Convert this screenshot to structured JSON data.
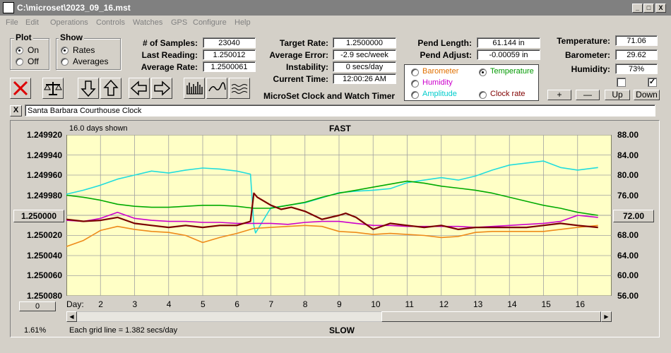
{
  "window": {
    "title": "C:\\microset\\2023_09_16.mst",
    "minimize": "_",
    "maximize": "□",
    "close": "X"
  },
  "menu": [
    "File",
    "Edit",
    "Operations",
    "Controls",
    "Watches",
    "GPS",
    "Configure",
    "Help"
  ],
  "plot_group": {
    "title": "Plot",
    "options": [
      "On",
      "Off"
    ],
    "selected": "On"
  },
  "show_group": {
    "title": "Show",
    "options": [
      "Rates",
      "Averages"
    ],
    "selected": "Rates"
  },
  "stats": {
    "samples_label": "# of Samples:",
    "samples": "23040",
    "last_label": "Last Reading:",
    "last": "1.250012",
    "avg_label": "Average Rate:",
    "avg": "1.2500061",
    "target_label": "Target Rate:",
    "target": "1.2500000",
    "err_label": "Average Error:",
    "err": "-2.9 sec/week",
    "inst_label": "Instability:",
    "inst": "0 secs/day",
    "time_label": "Current Time:",
    "time": "12:00:26 AM",
    "pend_label": "Pend Length:",
    "pend": "61.144 in",
    "adjust_label": "Pend Adjust:",
    "adjust": "-0.00059 in",
    "temp_label": "Temperature:",
    "temp": "71.06",
    "baro_label": "Barometer:",
    "baro": "29.62",
    "hum_label": "Humidity:",
    "hum": "73%"
  },
  "app_title": "MicroSet Clock and Watch Timer",
  "series_select": {
    "options": [
      {
        "label": "Barometer",
        "color": "#e07000",
        "selected": false
      },
      {
        "label": "Temperature",
        "color": "#009900",
        "selected": true
      },
      {
        "label": "Humidity",
        "color": "#cc00cc",
        "selected": false
      },
      {
        "label": "Clock rate",
        "color": "#800000",
        "selected": false
      },
      {
        "label": "Amplitude",
        "color": "#00cccc",
        "selected": false
      }
    ]
  },
  "scale_buttons": [
    "+",
    "—",
    "Up",
    "Down"
  ],
  "checkboxes": [
    false,
    true
  ],
  "clock_name": "Santa Barbara Courthouse Clock",
  "clock_close": "X",
  "chart": {
    "days_shown": "16.0 days shown",
    "top_label": "FAST",
    "bottom_label": "SLOW",
    "y_left_ticks": [
      "1.249920",
      "1.249940",
      "1.249960",
      "1.249980",
      "1.250000",
      "1.250020",
      "1.250040",
      "1.250060",
      "1.250080"
    ],
    "y_right_ticks": [
      "88.00",
      "84.00",
      "80.00",
      "76.00",
      "72.00",
      "68.00",
      "64.00",
      "60.00",
      "56.00"
    ],
    "x_ticks": [
      "Day:",
      "2",
      "3",
      "4",
      "5",
      "6",
      "7",
      "8",
      "9",
      "10",
      "11",
      "12",
      "13",
      "14",
      "15",
      "16"
    ],
    "left_center_button": "1.250000",
    "right_center_button": "72.00",
    "zero_button": "0",
    "percent": "1.61%",
    "grid_note": "Each grid line = 1.382 secs/day"
  },
  "chart_data": {
    "type": "line",
    "x_label": "Day:",
    "y_left_range": [
      1.24992,
      1.25008
    ],
    "y_right_range": [
      56,
      88
    ],
    "x_range": [
      1,
      17
    ],
    "series": [
      {
        "name": "Amplitude",
        "color": "#22dddd",
        "y_right": true,
        "x": [
          1,
          1.5,
          2,
          2.5,
          3,
          3.5,
          4,
          4.5,
          5,
          5.5,
          6,
          6.4,
          6.5,
          6.55,
          7,
          7.5,
          8,
          8.5,
          9,
          9.5,
          10,
          10.5,
          11,
          11.5,
          12,
          12.5,
          13,
          13.5,
          14,
          14.5,
          15,
          15.5,
          16,
          16.6
        ],
        "y": [
          76.2,
          77.0,
          78.0,
          79.2,
          80.0,
          80.8,
          80.4,
          81.0,
          81.4,
          81.2,
          80.8,
          80.2,
          70.0,
          68.5,
          73.5,
          74.0,
          74.5,
          75.5,
          76.5,
          76.8,
          77.0,
          77.3,
          78.5,
          79.0,
          79.5,
          79.0,
          79.8,
          81.0,
          82.0,
          82.4,
          82.8,
          81.5,
          81.0,
          81.5
        ]
      },
      {
        "name": "Temperature",
        "color": "#00aa00",
        "y_right": true,
        "x": [
          1,
          1.5,
          2,
          2.5,
          3,
          3.5,
          4,
          4.5,
          5,
          5.5,
          6,
          6.5,
          7,
          7.5,
          8,
          8.5,
          9,
          9.5,
          10,
          10.5,
          11,
          11.5,
          12,
          12.5,
          13,
          13.5,
          14,
          14.5,
          15,
          15.5,
          16,
          16.6
        ],
        "y": [
          76.0,
          75.6,
          75.0,
          74.2,
          73.8,
          73.6,
          73.6,
          73.8,
          74.0,
          74.0,
          73.8,
          73.4,
          73.4,
          74.0,
          74.6,
          75.6,
          76.4,
          77.0,
          77.6,
          78.2,
          78.8,
          78.4,
          77.8,
          77.4,
          77.0,
          76.4,
          75.6,
          74.8,
          74.0,
          73.4,
          72.6,
          72.0
        ]
      },
      {
        "name": "Humidity",
        "color": "#cc00cc",
        "y_right": true,
        "x": [
          1,
          1.5,
          2,
          2.5,
          3,
          3.5,
          4,
          4.5,
          5,
          5.5,
          6,
          6.5,
          7,
          7.5,
          8,
          8.5,
          9,
          9.5,
          10,
          10.5,
          11,
          11.5,
          12,
          12.5,
          13,
          13.5,
          14,
          14.5,
          15,
          15.5,
          16,
          16.6
        ],
        "y": [
          71.0,
          70.8,
          71.4,
          72.6,
          71.4,
          71.0,
          70.8,
          70.8,
          70.6,
          70.6,
          70.4,
          70.4,
          70.4,
          70.2,
          70.6,
          70.8,
          70.8,
          70.4,
          70.0,
          70.0,
          69.8,
          69.8,
          69.8,
          69.8,
          69.6,
          69.8,
          70.0,
          70.2,
          70.4,
          70.8,
          72.0,
          71.6
        ]
      },
      {
        "name": "Barometer",
        "color": "#ee8a1a",
        "y_right": true,
        "x": [
          1,
          1.5,
          2,
          2.5,
          3,
          3.5,
          4,
          4.5,
          5,
          5.5,
          6,
          6.5,
          7,
          7.5,
          8,
          8.5,
          9,
          9.5,
          10,
          10.5,
          11,
          11.5,
          12,
          12.5,
          13,
          13.5,
          14,
          14.5,
          15,
          15.5,
          16,
          16.6
        ],
        "y": [
          65.8,
          67.0,
          69.0,
          69.8,
          69.2,
          68.8,
          68.6,
          68.0,
          66.6,
          67.6,
          68.4,
          69.4,
          69.6,
          69.8,
          70.0,
          69.8,
          68.8,
          68.6,
          68.2,
          68.4,
          68.2,
          68.0,
          67.6,
          67.8,
          68.6,
          68.8,
          68.8,
          68.8,
          68.8,
          69.2,
          69.6,
          70.0
        ]
      },
      {
        "name": "Clock rate",
        "color": "#7a0000",
        "y_right": false,
        "x": [
          1,
          1.5,
          2,
          2.5,
          3,
          3.5,
          4,
          4.5,
          5,
          5.5,
          6,
          6.4,
          6.5,
          6.6,
          7,
          7.3,
          7.6,
          8,
          8.5,
          9,
          9.2,
          9.5,
          10,
          10.5,
          11,
          11.5,
          12,
          12.5,
          13,
          13.5,
          14,
          14.5,
          15,
          15.5,
          16,
          16.6
        ],
        "y": [
          1.250004,
          1.250006,
          1.250005,
          1.250002,
          1.250008,
          1.25001,
          1.250012,
          1.25001,
          1.250012,
          1.25001,
          1.25001,
          1.250006,
          1.249978,
          1.249982,
          1.24999,
          1.249994,
          1.249992,
          1.249996,
          1.250004,
          1.25,
          1.249998,
          1.250002,
          1.250014,
          1.250008,
          1.25001,
          1.250012,
          1.25001,
          1.250014,
          1.250012,
          1.250012,
          1.250012,
          1.250012,
          1.25001,
          1.250008,
          1.25001,
          1.250012
        ]
      }
    ]
  }
}
